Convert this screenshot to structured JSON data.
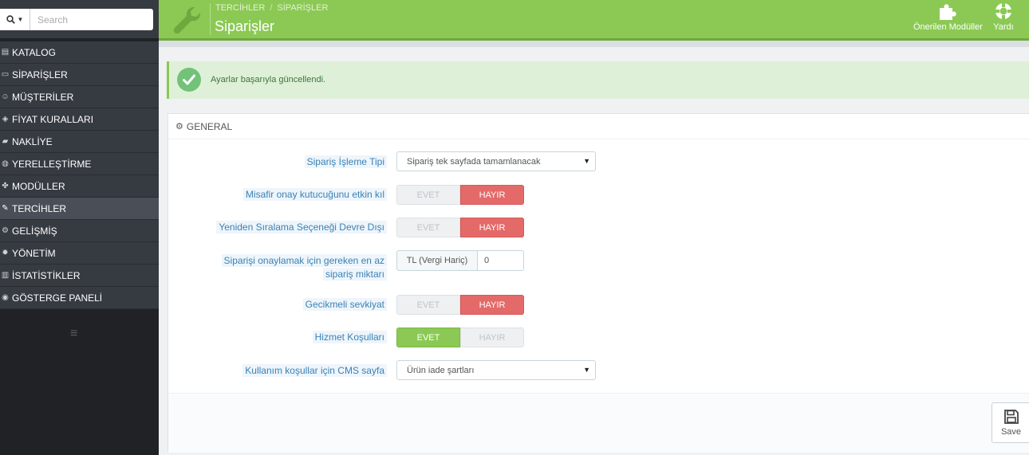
{
  "search": {
    "placeholder": "Search"
  },
  "sidebar": {
    "items": [
      {
        "label": "KATALOG",
        "icon": "book-icon"
      },
      {
        "label": "SİPARİŞLER",
        "icon": "credit-card-icon"
      },
      {
        "label": "MÜŞTERİLER",
        "icon": "users-icon"
      },
      {
        "label": "FİYAT KURALLARI",
        "icon": "tags-icon"
      },
      {
        "label": "NAKLİYE",
        "icon": "truck-icon"
      },
      {
        "label": "YERELLEŞTİRME",
        "icon": "globe-icon"
      },
      {
        "label": "MODÜLLER",
        "icon": "puzzle-icon"
      },
      {
        "label": "TERCİHLER",
        "icon": "wrench-icon"
      },
      {
        "label": "GELİŞMİŞ",
        "icon": "cogs-icon"
      },
      {
        "label": "YÖNETİM",
        "icon": "gear-icon"
      },
      {
        "label": "İSTATİSTİKLER",
        "icon": "bar-chart-icon"
      },
      {
        "label": "GÖSTERGE PANELİ",
        "icon": "dashboard-icon"
      }
    ],
    "active": "TERCİHLER"
  },
  "header": {
    "breadcrumb": [
      "TERCİHLER",
      "SİPARİŞLER"
    ],
    "title": "Siparişler",
    "modules_label": "Önerilen Modüller",
    "help_label": "Yardı"
  },
  "alert": {
    "text": "Ayarlar başarıyla güncellendi."
  },
  "panel": {
    "heading": "GENERAL",
    "fields": {
      "order_process": {
        "label": "Sipariş İşleme Tipi",
        "value": "Sipariş tek sayfada tamamlanacak"
      },
      "guest_checkbox": {
        "label": "Misafir onay kutucuğunu etkin kıl",
        "yes": "EVET",
        "no": "HAYIR",
        "value": "HAYIR"
      },
      "reorder": {
        "label": "Yeniden Sıralama Seçeneği Devre Dışı",
        "yes": "EVET",
        "no": "HAYIR",
        "value": "HAYIR"
      },
      "min_amount": {
        "label_line1": "Siparişi onaylamak için gereken en az",
        "label_line2": "sipariş miktarı",
        "addon": "TL (Vergi Hariç)",
        "value": "0"
      },
      "delayed_shipping": {
        "label": "Gecikmeli sevkiyat",
        "yes": "EVET",
        "no": "HAYIR",
        "value": "HAYIR"
      },
      "terms": {
        "label": "Hizmet Koşulları",
        "yes": "EVET",
        "no": "HAYIR",
        "value": "EVET"
      },
      "cms_page": {
        "label": "Kullanım koşullar için CMS sayfa",
        "value": "Ürün iade şartları"
      }
    },
    "save_label": "Save"
  },
  "colors": {
    "header_green": "#8bc954",
    "sidebar": "#363a41",
    "no_red": "#e36a68",
    "yes_green": "#8bc954",
    "label_blue": "#3a82b5"
  }
}
